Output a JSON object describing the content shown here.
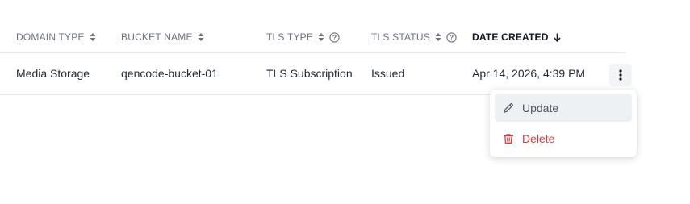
{
  "table": {
    "columns": [
      {
        "label": "DOMAIN TYPE",
        "sortable": true,
        "help": false
      },
      {
        "label": "BUCKET NAME",
        "sortable": true,
        "help": false
      },
      {
        "label": "TLS TYPE",
        "sortable": true,
        "help": true
      },
      {
        "label": "TLS STATUS",
        "sortable": true,
        "help": true
      },
      {
        "label": "DATE CREATED",
        "sort": "descending",
        "active": true
      }
    ],
    "rows": [
      {
        "domain_type": "Media Storage",
        "bucket_name": "qencode-bucket-01",
        "tls_type": "TLS Subscription",
        "tls_status": "Issued",
        "date_created": "Apr 14, 2026, 4:39 PM"
      }
    ]
  },
  "row_menu": {
    "items": [
      {
        "label": "Update",
        "icon": "pencil-icon"
      },
      {
        "label": "Delete",
        "icon": "trash-icon",
        "color": "#e0373c"
      }
    ]
  },
  "colors": {
    "header_text": "#6b7280",
    "active_header_text": "#111827",
    "danger": "#e0373c",
    "hover_bg": "#eef1f4"
  }
}
